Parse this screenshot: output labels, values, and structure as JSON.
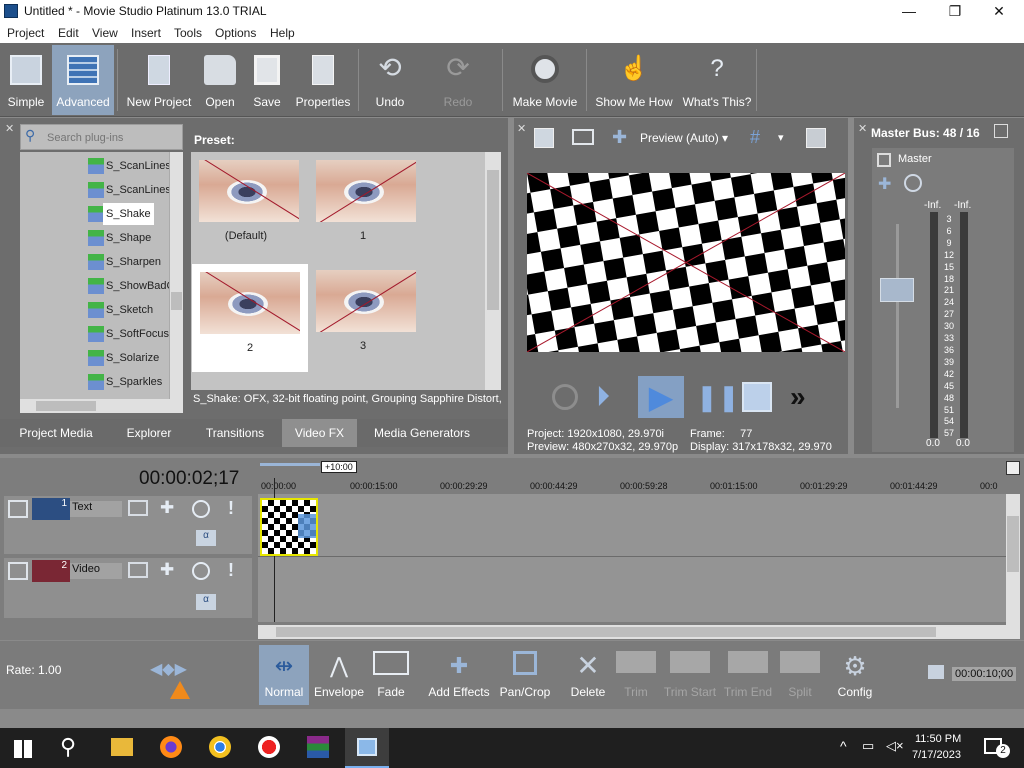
{
  "window": {
    "title": "Untitled * - Movie Studio Platinum 13.0 TRIAL",
    "min": "—",
    "max": "❐",
    "close": "✕"
  },
  "menu": [
    "Project",
    "Edit",
    "View",
    "Insert",
    "Tools",
    "Options",
    "Help"
  ],
  "toolbar": [
    {
      "label": "Simple",
      "icon": "simple-layout-icon"
    },
    {
      "label": "Advanced",
      "icon": "advanced-layout-icon"
    },
    {
      "label": "New Project",
      "icon": "new-project-icon"
    },
    {
      "label": "Open",
      "icon": "folder-icon"
    },
    {
      "label": "Save",
      "icon": "floppy-icon"
    },
    {
      "label": "Properties",
      "icon": "properties-icon"
    },
    {
      "label": "Undo",
      "icon": "undo-icon"
    },
    {
      "label": "Redo",
      "icon": "redo-icon"
    },
    {
      "label": "Make Movie",
      "icon": "film-reel-icon"
    },
    {
      "label": "Show Me How",
      "icon": "pointing-hand-icon"
    },
    {
      "label": "What's This?",
      "icon": "help-cursor-icon"
    }
  ],
  "plugins": {
    "search_placeholder": "Search plug-ins",
    "items": [
      "S_ScanLines",
      "S_ScanLinesI",
      "S_Shake",
      "S_Shape",
      "S_Sharpen",
      "S_ShowBadC",
      "S_Sketch",
      "S_SoftFocus",
      "S_Solarize",
      "S_Sparkles"
    ],
    "selected": "S_Shake"
  },
  "presets": {
    "title": "Preset:",
    "items": [
      "(Default)",
      "1",
      "2",
      "3"
    ],
    "status": "S_Shake: OFX, 32-bit floating point, Grouping  Sapphire Distort,"
  },
  "tabs": [
    "Project Media",
    "Explorer",
    "Transitions",
    "Video FX",
    "Media Generators"
  ],
  "active_tab": "Video FX",
  "preview": {
    "mode": "Preview (Auto)",
    "project_label": "Project:",
    "project_value": "1920x1080, 29.970i",
    "preview_label": "Preview:",
    "preview_value": "480x270x32, 29.970p",
    "frame_label": "Frame:",
    "frame_value": "77",
    "display_label": "Display:",
    "display_value": "317x178x32, 29.970"
  },
  "master": {
    "title": "Master Bus: 48 / 16",
    "name": "Master",
    "inf_left": "-Inf.",
    "inf_right": "-Inf.",
    "scale": [
      "3",
      "6",
      "9",
      "12",
      "15",
      "18",
      "21",
      "24",
      "27",
      "30",
      "33",
      "36",
      "39",
      "42",
      "45",
      "48",
      "51",
      "54",
      "57"
    ],
    "bottom_left": "0.0",
    "bottom_right": "0.0"
  },
  "timeline": {
    "timecode": "00:00:02;17",
    "offset": "+10:00",
    "ruler": [
      "00:00:00",
      "00:00:15:00",
      "00:00:29:29",
      "00:00:44:29",
      "00:00:59:28",
      "00:01:15:00",
      "00:01:29:29",
      "00:01:44:29",
      "00:0"
    ],
    "tracks": [
      {
        "num": "1",
        "name": "Text"
      },
      {
        "num": "2",
        "name": "Video"
      }
    ]
  },
  "bottom": {
    "rate": "Rate: 1.00",
    "tools": [
      "Normal",
      "Envelope",
      "Fade",
      "Add Effects",
      "Pan/Crop",
      "Delete",
      "Trim",
      "Trim Start",
      "Trim End",
      "Split",
      "Config"
    ],
    "end_time": "00:00:10;00"
  },
  "taskbar": {
    "time": "11:50 PM",
    "date": "7/17/2023",
    "notif": "2"
  }
}
